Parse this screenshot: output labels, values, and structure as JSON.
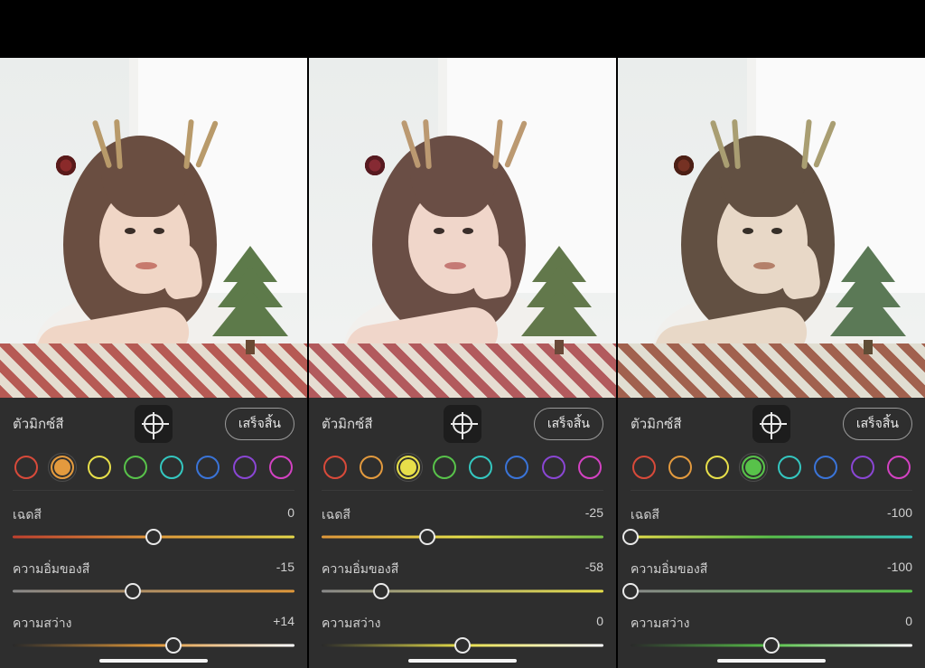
{
  "labels": {
    "title": "ตัวมิกซ์สี",
    "done": "เสร็จสิ้น",
    "hue": "เฉดสี",
    "sat": "ความอิ่มของสี",
    "lum": "ความสว่าง"
  },
  "swatch_colors": [
    "red",
    "orange",
    "yellow",
    "green",
    "aqua",
    "blue",
    "purple",
    "magenta"
  ],
  "panes": [
    {
      "selected_swatch": "orange",
      "sliders": {
        "hue": {
          "value": "0",
          "pct": 50,
          "grad": "linear-gradient(90deg,#c2402e,#e0983a,#e5d84a)"
        },
        "sat": {
          "value": "-15",
          "pct": 42.5,
          "grad": "linear-gradient(90deg,#8a8a8a,#e0983a)"
        },
        "lum": {
          "value": "+14",
          "pct": 57,
          "grad": "linear-gradient(90deg,#2a2a2a,#e0983a,#ffffff)"
        }
      }
    },
    {
      "selected_swatch": "yellow",
      "sliders": {
        "hue": {
          "value": "-25",
          "pct": 37.5,
          "grad": "linear-gradient(90deg,#e0983a,#e7df4a,#7ac24a)"
        },
        "sat": {
          "value": "-58",
          "pct": 21,
          "grad": "linear-gradient(90deg,#8a8a8a,#e7df4a)"
        },
        "lum": {
          "value": "0",
          "pct": 50,
          "grad": "linear-gradient(90deg,#2a2a2a,#e7df4a,#ffffff)"
        }
      }
    },
    {
      "selected_swatch": "green",
      "sliders": {
        "hue": {
          "value": "-100",
          "pct": 0,
          "grad": "linear-gradient(90deg,#e7df4a,#58c24a,#34c7c0)"
        },
        "sat": {
          "value": "-100",
          "pct": 0,
          "grad": "linear-gradient(90deg,#8a8a8a,#58c24a)"
        },
        "lum": {
          "value": "0",
          "pct": 50,
          "grad": "linear-gradient(90deg,#2a2a2a,#58c24a,#ffffff)"
        }
      }
    }
  ]
}
